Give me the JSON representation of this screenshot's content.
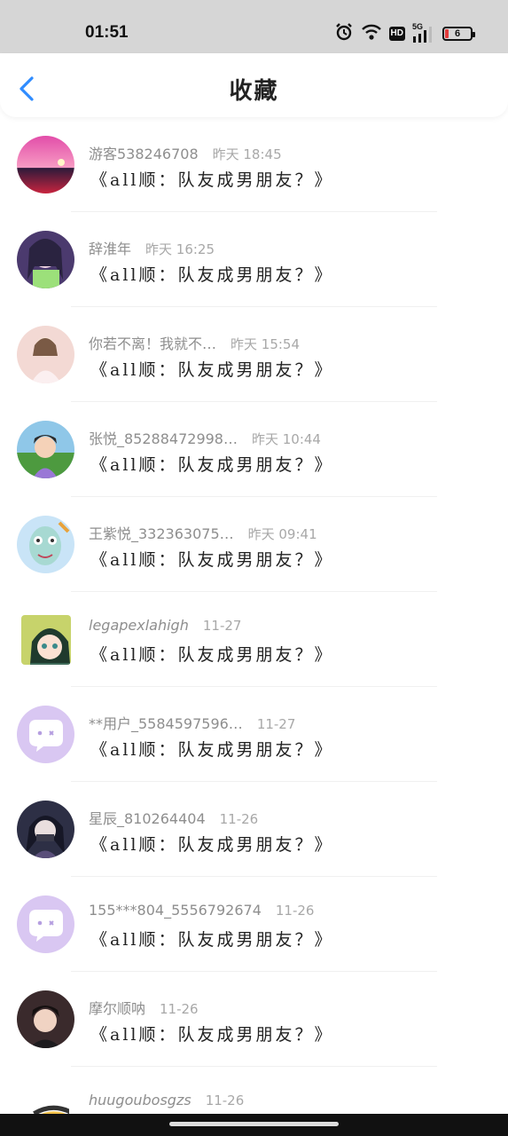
{
  "status": {
    "time": "01:51",
    "battery": "6",
    "network": "5G",
    "hd": "HD"
  },
  "header": {
    "title": "收藏"
  },
  "colors": {
    "accent": "#2f8cff",
    "meta_text": "#8e8e8e",
    "title_text": "#222222"
  },
  "items": [
    {
      "user": "游客538246708",
      "time": "昨天 18:45",
      "title": "《all顺：队友成男朋友？》",
      "avatar": "sunset-photo"
    },
    {
      "user": "辞淮年",
      "time": "昨天 16:25",
      "title": "《all顺：队友成男朋友？》",
      "avatar": "anime-girl"
    },
    {
      "user": "你若不离！我就不…",
      "time": "昨天 15:54",
      "title": "《all顺：队友成男朋友？》",
      "avatar": "girl-photo"
    },
    {
      "user": "张悦_85288472998…",
      "time": "昨天 10:44",
      "title": "《all顺：队友成男朋友？》",
      "avatar": "child-photo"
    },
    {
      "user": "王紫悦_332363075…",
      "time": "昨天 09:41",
      "title": "《all顺：队友成男朋友？》",
      "avatar": "cartoon-squid"
    },
    {
      "user": "legapexlahigh",
      "time": "11-27",
      "title": "《all顺：队友成男朋友？》",
      "avatar": "anime-chibi"
    },
    {
      "user": "**用户_5584597596…",
      "time": "11-27",
      "title": "《all顺：队友成男朋友？》",
      "avatar": "default-chat"
    },
    {
      "user": "星辰_810264404",
      "time": "11-26",
      "title": "《all顺：队友成男朋友？》",
      "avatar": "anime-boy"
    },
    {
      "user": "155***804_5556792674",
      "time": "11-26",
      "title": "《all顺：队友成男朋友？》",
      "avatar": "default-chat"
    },
    {
      "user": "摩尔顺呐",
      "time": "11-26",
      "title": "《all顺：队友成男朋友？》",
      "avatar": "boy-photo"
    },
    {
      "user": "huugoubosgzs",
      "time": "11-26",
      "title": "",
      "avatar": "cartoon-face"
    }
  ]
}
